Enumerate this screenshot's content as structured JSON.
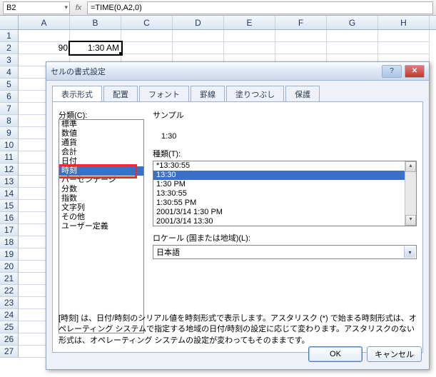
{
  "namebox": "B2",
  "formula": "=TIME(0,A2,0)",
  "columns": [
    "A",
    "B",
    "C",
    "D",
    "E",
    "F",
    "G",
    "H"
  ],
  "row_numbers": [
    1,
    2,
    3,
    4,
    5,
    6,
    7,
    8,
    9,
    10,
    11,
    12,
    13,
    14,
    15,
    16,
    17,
    18,
    19,
    20,
    21,
    22,
    23,
    24,
    25,
    26,
    27
  ],
  "cells": {
    "A2": "90",
    "B2": "1:30 AM"
  },
  "dialog": {
    "title": "セルの書式設定",
    "tabs": [
      "表示形式",
      "配置",
      "フォント",
      "罫線",
      "塗りつぶし",
      "保護"
    ],
    "selected_tab": "表示形式",
    "category_label": "分類(C):",
    "categories": [
      "標準",
      "数値",
      "通貨",
      "会計",
      "日付",
      "時刻",
      "パーセンテージ",
      "分数",
      "指数",
      "文字列",
      "その他",
      "ユーザー定義"
    ],
    "selected_category": "時刻",
    "sample_label": "サンプル",
    "sample_value": "1:30",
    "type_label": "種類(T):",
    "types": [
      "*13:30:55",
      "13:30",
      "1:30 PM",
      "13:30:55",
      "1:30:55 PM",
      "2001/3/14 1:30 PM",
      "2001/3/14 13:30"
    ],
    "selected_type": "13:30",
    "locale_label": "ロケール (国または地域)(L):",
    "locale_value": "日本語",
    "description": "[時刻] は、日付/時刻のシリアル値を時刻形式で表示します。アスタリスク (*) で始まる時刻形式は、オペレーティング システムで指定する地域の日付/時刻の設定に応じて変わります。アスタリスクのない形式は、オペレーティング システムの設定が変わってもそのままです。",
    "ok": "OK",
    "cancel": "キャンセル"
  }
}
